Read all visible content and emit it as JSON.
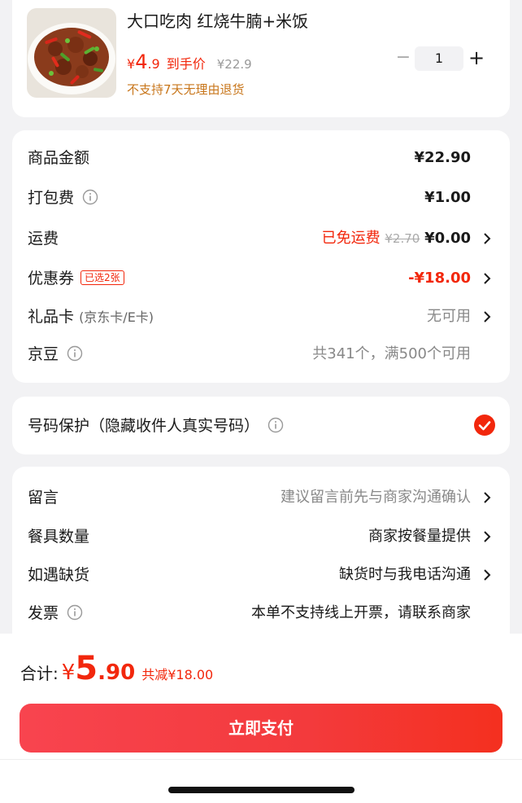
{
  "product": {
    "title": "大口吃肉 红烧牛腩+米饭",
    "price_yen": "¥",
    "price_int": "4",
    "price_dec": ".9",
    "price_label": "到手价",
    "original_price": "¥22.9",
    "return_note": "不支持7天无理由退货",
    "quantity": "1",
    "minus": "−",
    "plus": "+"
  },
  "fees": {
    "goods_amount": {
      "label": "商品金额",
      "value": "¥22.90"
    },
    "packing_fee": {
      "label": "打包费",
      "value": "¥1.00"
    },
    "shipping": {
      "label": "运费",
      "free_text": "已免运费",
      "original": "¥2.70",
      "value": "¥0.00"
    },
    "coupon": {
      "label": "优惠券",
      "badge": "已选2张",
      "value": "-¥18.00"
    },
    "gift_card": {
      "label": "礼品卡",
      "sub": "(京东卡/E卡)",
      "value": "无可用"
    },
    "jingdou": {
      "label": "京豆",
      "value": "共341个，满500个可用"
    }
  },
  "privacy": {
    "label": "号码保护（隐藏收件人真实号码）"
  },
  "extras": {
    "message": {
      "label": "留言",
      "value": "建议留言前先与商家沟通确认"
    },
    "tableware": {
      "label": "餐具数量",
      "value": "商家按餐量提供"
    },
    "out_of_stock": {
      "label": "如遇缺货",
      "value": "缺货时与我电话沟通"
    },
    "invoice": {
      "label": "发票",
      "value": "本单不支持线上开票，请联系商家"
    }
  },
  "summary": {
    "total_label": "合计:",
    "total_yen": "¥",
    "total_int": "5",
    "total_dec": ".90",
    "saved": "共减¥18.00",
    "pay_button": "立即支付"
  },
  "colors": {
    "accent": "#f2270c",
    "note": "#c8761b",
    "background": "#f2f2f4"
  }
}
